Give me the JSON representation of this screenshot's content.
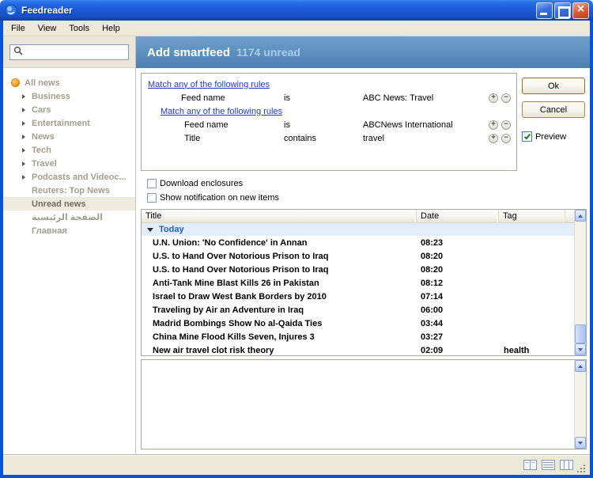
{
  "window": {
    "title": "Feedreader"
  },
  "menubar": {
    "items": [
      {
        "label": "File"
      },
      {
        "label": "View"
      },
      {
        "label": "Tools"
      },
      {
        "label": "Help"
      }
    ]
  },
  "sidebar": {
    "search": {
      "value": ""
    },
    "items": [
      {
        "label": "All news"
      },
      {
        "label": "Business"
      },
      {
        "label": "Cars"
      },
      {
        "label": "Entertainment"
      },
      {
        "label": "News"
      },
      {
        "label": "Tech"
      },
      {
        "label": "Travel"
      },
      {
        "label": "Podcasts and Videoc..."
      },
      {
        "label": "Reuters: Top News"
      },
      {
        "label": "Unread news"
      },
      {
        "label": "الصفحة الرئيسية"
      },
      {
        "label": "Главная"
      }
    ]
  },
  "header": {
    "title": "Add smartfeed",
    "unread_count": "1174 unread"
  },
  "rules": {
    "group1": {
      "link": "Match any of the following rules"
    },
    "group2": {
      "link": "Match any of the following rules"
    },
    "rows": [
      {
        "field": "Feed name",
        "operator": "is",
        "value": "ABC News: Travel"
      },
      {
        "field": "Feed name",
        "operator": "is",
        "value": "ABCNews International"
      },
      {
        "field": "Title",
        "operator": "contains",
        "value": "travel"
      }
    ]
  },
  "actions": {
    "ok": "Ok",
    "cancel": "Cancel",
    "preview": "Preview",
    "preview_checked": true
  },
  "options": {
    "items": [
      {
        "label": "Download enclosures",
        "checked": false
      },
      {
        "label": "Show notification on new items",
        "checked": false
      }
    ]
  },
  "article_table": {
    "columns": [
      {
        "label": "Title"
      },
      {
        "label": "Date"
      },
      {
        "label": "Tag"
      }
    ],
    "group_label": "Today",
    "rows": [
      {
        "title": "U.N. Union: 'No Confidence' in Annan",
        "date": "08:23",
        "tag": ""
      },
      {
        "title": "U.S. to Hand Over Notorious Prison to Iraq",
        "date": "08:20",
        "tag": ""
      },
      {
        "title": "U.S. to Hand Over Notorious Prison to Iraq",
        "date": "08:20",
        "tag": ""
      },
      {
        "title": "Anti-Tank Mine Blast Kills 26 in Pakistan",
        "date": "08:12",
        "tag": ""
      },
      {
        "title": "Israel to Draw West Bank Borders by 2010",
        "date": "07:14",
        "tag": ""
      },
      {
        "title": "Traveling by Air an Adventure in Iraq",
        "date": "06:00",
        "tag": ""
      },
      {
        "title": "Madrid Bombings Show No al-Qaida Ties",
        "date": "03:44",
        "tag": ""
      },
      {
        "title": "China Mine Flood Kills Seven, Injures 3",
        "date": "03:27",
        "tag": ""
      },
      {
        "title": "New air travel clot risk theory",
        "date": "02:09",
        "tag": "health"
      }
    ]
  },
  "icons": {
    "app": "feedreader-logo",
    "search": "magnifier",
    "all_news": "orange-ball",
    "expand": "triangle-right",
    "collapse": "triangle-down",
    "add_rule": "plus-circle",
    "remove_rule": "minus-circle",
    "minimize": "underscore",
    "maximize": "square",
    "close": "x"
  },
  "colors": {
    "frame": "#0A53D8",
    "titlebar-light": "#3E8CF0",
    "titlebar-dark": "#1A50C4",
    "header-light": "#6FA0CC",
    "header-dark": "#4C80B2",
    "link-blue": "#2239C5",
    "today-blue": "#1E5FBE",
    "sidebar-text": "#A49D8C",
    "selection-bg": "#EDEBDF"
  }
}
